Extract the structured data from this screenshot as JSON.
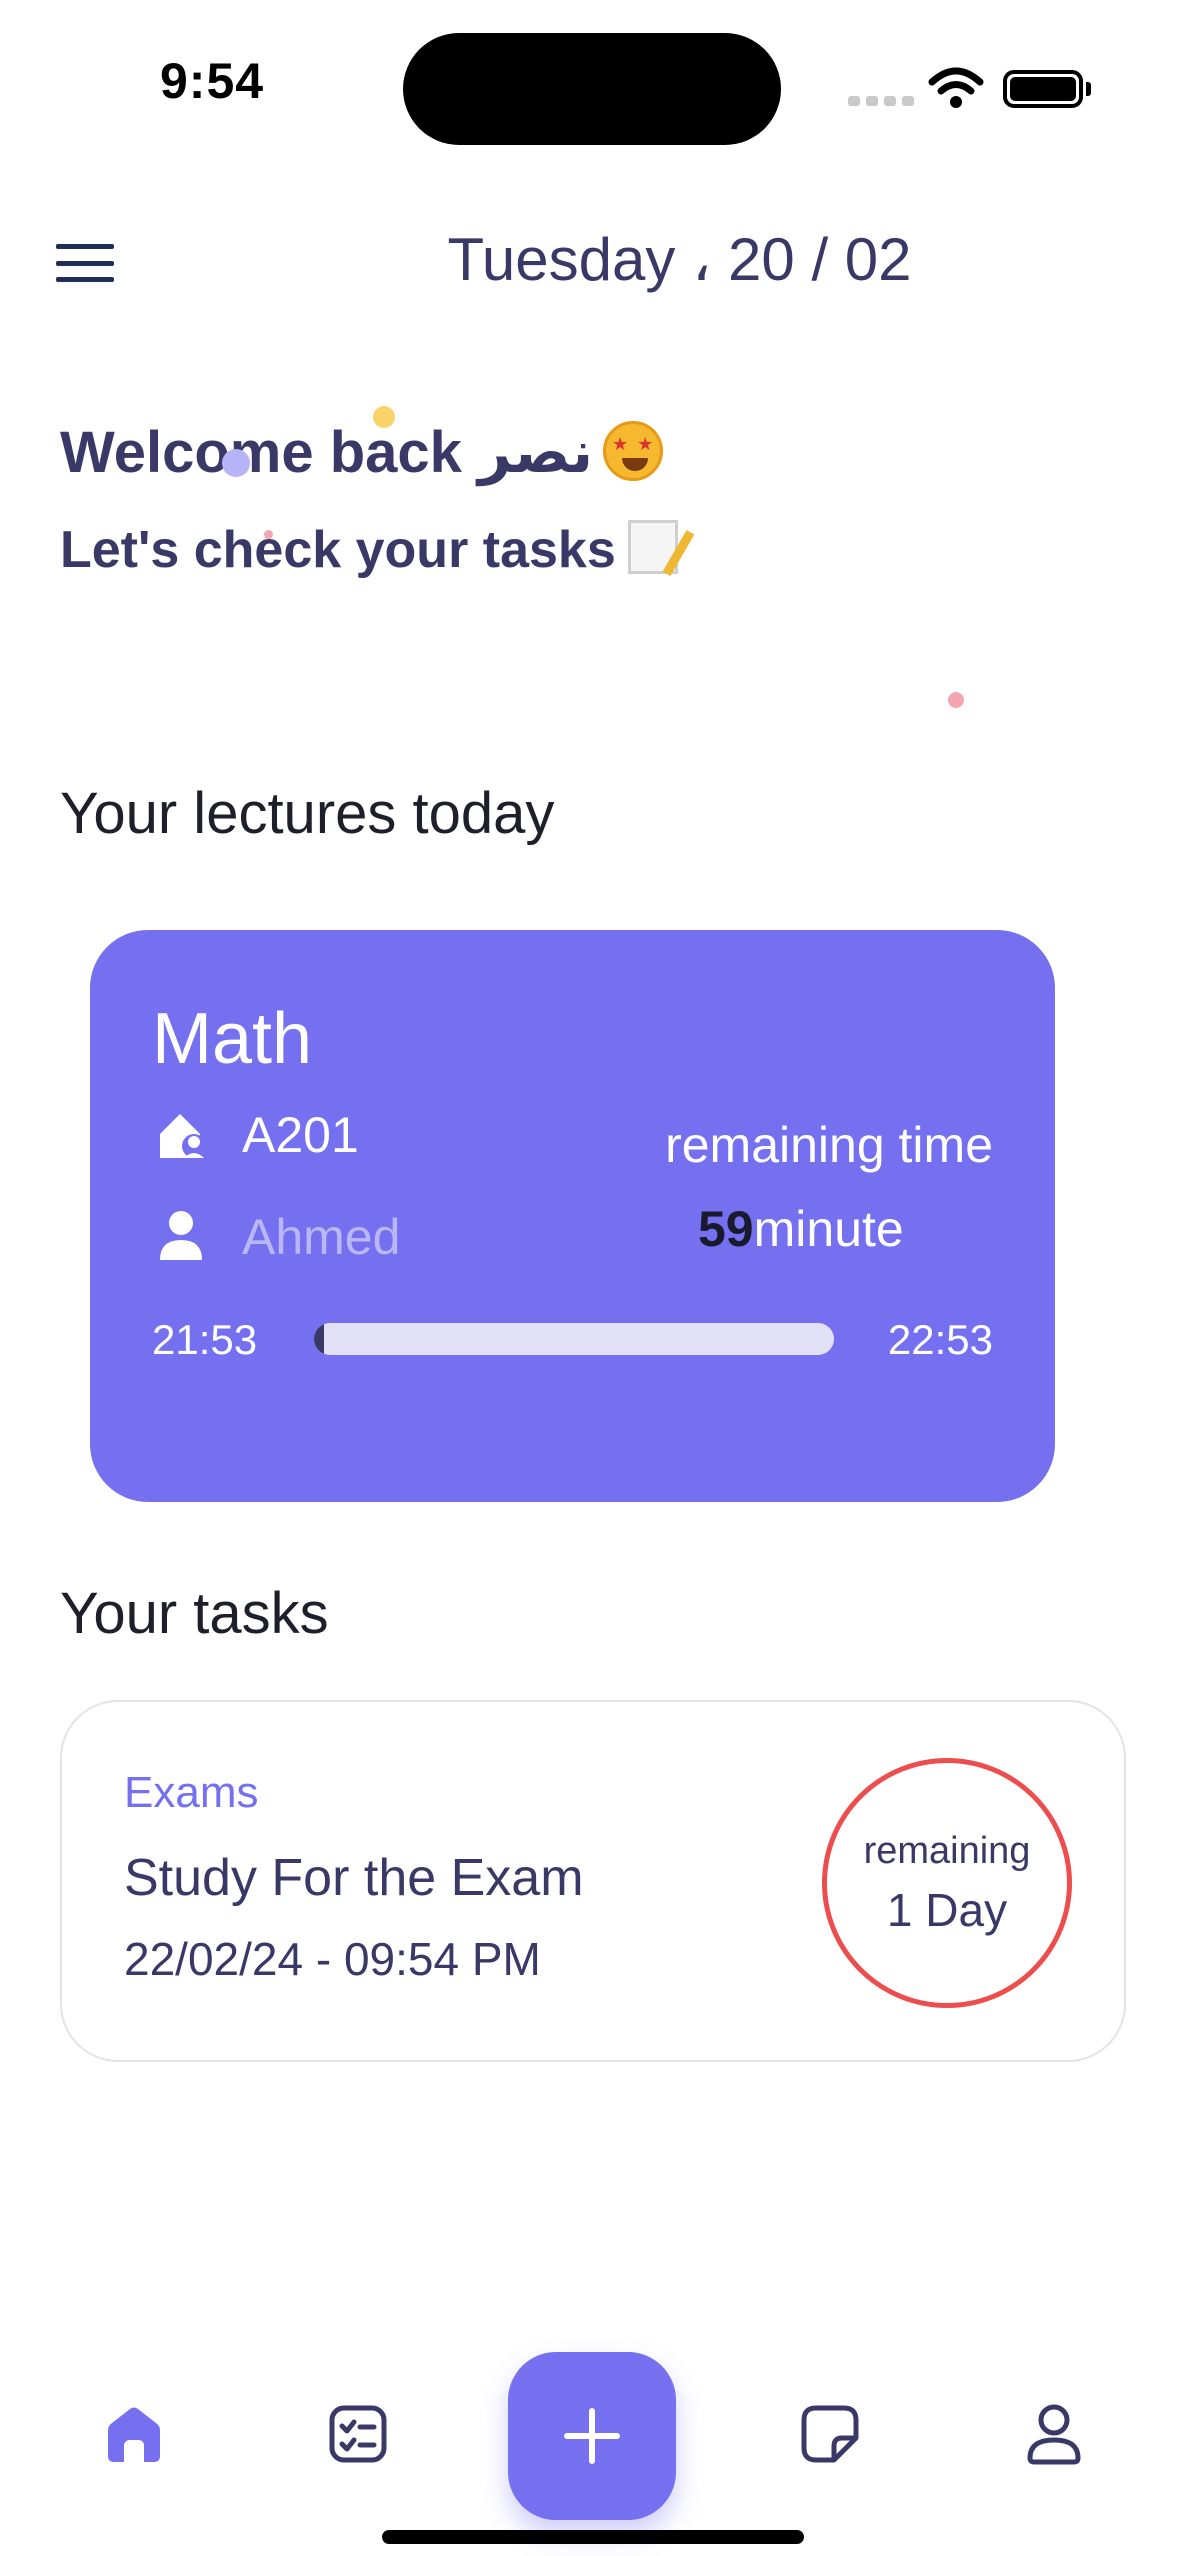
{
  "status_bar": {
    "time": "9:54"
  },
  "header": {
    "date": "Tuesday ، 20 / 02",
    "menu_icon": "menu-icon"
  },
  "greeting": {
    "welcome": "Welcome back نصر",
    "welcome_emoji": "star-struck-emoji",
    "subtitle": "Let's check your tasks",
    "subtitle_emoji": "memo-emoji"
  },
  "lectures": {
    "section_title": "Your lectures today",
    "items": [
      {
        "subject": "Math",
        "room": "A201",
        "teacher": "Ahmed",
        "remaining_label": "remaining time",
        "remaining_number": "59",
        "remaining_unit": "minute",
        "start_time": "21:53",
        "end_time": "22:53",
        "progress_fraction": 0.02
      }
    ]
  },
  "tasks": {
    "section_title": "Your tasks",
    "items": [
      {
        "category": "Exams",
        "title": "Study For the Exam",
        "due": "22/02/24 - 09:54 PM",
        "remaining_label": "remaining",
        "remaining_value": "1 Day"
      }
    ]
  },
  "bottom_nav": {
    "items": [
      "home-icon",
      "tasks-checklist-icon",
      "add-icon",
      "note-icon",
      "profile-icon"
    ],
    "active": "home-icon"
  },
  "colors": {
    "accent": "#7470f0",
    "text_primary": "#3a3866",
    "danger": "#ee4d4d",
    "card_muted_text": "#b9b7f7"
  }
}
